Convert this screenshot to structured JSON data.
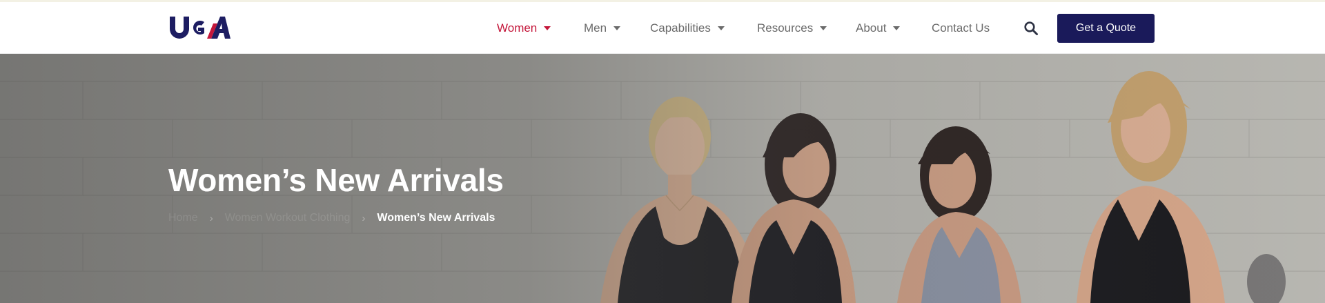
{
  "header": {
    "logo_alt": "UGA",
    "nav": [
      {
        "label": "Women",
        "active": true,
        "has_dropdown": true
      },
      {
        "label": "Men",
        "active": false,
        "has_dropdown": true
      },
      {
        "label": "Capabilities",
        "active": false,
        "has_dropdown": true
      },
      {
        "label": "Resources",
        "active": false,
        "has_dropdown": true
      },
      {
        "label": "About",
        "active": false,
        "has_dropdown": true
      },
      {
        "label": "Contact Us",
        "active": false,
        "has_dropdown": false
      }
    ],
    "search_icon": "search-icon",
    "quote_button": "Get a Quote"
  },
  "hero": {
    "title": "Women’s New Arrivals",
    "breadcrumb": {
      "home": "Home",
      "parent": "Women Workout Clothing",
      "current": "Women’s New Arrivals"
    }
  },
  "colors": {
    "accent": "#c4163a",
    "brand_navy": "#1a1a5a",
    "nav_text": "#6b6b6b"
  }
}
